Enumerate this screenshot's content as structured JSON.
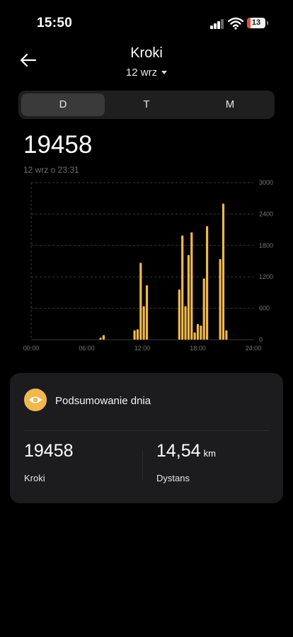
{
  "status_bar": {
    "time": "15:50",
    "battery": "13"
  },
  "header": {
    "title": "Kroki",
    "date": "12 wrz"
  },
  "segments": [
    {
      "label": "D",
      "active": true
    },
    {
      "label": "T",
      "active": false
    },
    {
      "label": "M",
      "active": false
    }
  ],
  "summary_top": {
    "total": "19458",
    "timestamp": "12 wrz o 23:31"
  },
  "chart_data": {
    "type": "bar",
    "x_ticks": [
      "00:00",
      "06:00",
      "12:00",
      "18:00",
      "24:00"
    ],
    "y_ticks": [
      "0",
      "600",
      "1200",
      "1800",
      "2400",
      "3000"
    ],
    "ylim": [
      0,
      3000
    ],
    "xlim_minutes": [
      0,
      1440
    ],
    "bar_color": "#f0b84e",
    "bars": [
      {
        "minute": 450,
        "value": 40
      },
      {
        "minute": 470,
        "value": 90
      },
      {
        "minute": 670,
        "value": 180
      },
      {
        "minute": 690,
        "value": 200
      },
      {
        "minute": 710,
        "value": 1470
      },
      {
        "minute": 730,
        "value": 640
      },
      {
        "minute": 750,
        "value": 1040
      },
      {
        "minute": 960,
        "value": 960
      },
      {
        "minute": 980,
        "value": 1990
      },
      {
        "minute": 1000,
        "value": 640
      },
      {
        "minute": 1020,
        "value": 1620
      },
      {
        "minute": 1040,
        "value": 2050
      },
      {
        "minute": 1060,
        "value": 140
      },
      {
        "minute": 1080,
        "value": 300
      },
      {
        "minute": 1100,
        "value": 270
      },
      {
        "minute": 1120,
        "value": 1170
      },
      {
        "minute": 1140,
        "value": 2170
      },
      {
        "minute": 1225,
        "value": 1540
      },
      {
        "minute": 1245,
        "value": 2600
      },
      {
        "minute": 1265,
        "value": 180
      }
    ]
  },
  "summary_card": {
    "title": "Podsumowanie dnia",
    "steps_value": "19458",
    "steps_label": "Kroki",
    "distance_value": "14,54",
    "distance_unit": "km",
    "distance_label": "Dystans"
  }
}
